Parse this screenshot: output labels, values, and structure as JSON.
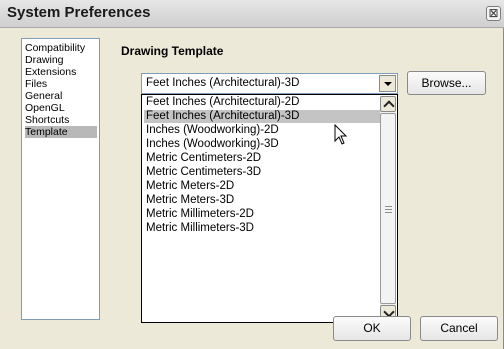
{
  "window": {
    "title": "System Preferences",
    "close_symbol": "⊠"
  },
  "sidebar": {
    "items": [
      {
        "label": "Compatibility"
      },
      {
        "label": "Drawing"
      },
      {
        "label": "Extensions"
      },
      {
        "label": "Files"
      },
      {
        "label": "General"
      },
      {
        "label": "OpenGL"
      },
      {
        "label": "Shortcuts"
      },
      {
        "label": "Template"
      }
    ],
    "selected_index": 7
  },
  "main": {
    "heading": "Drawing Template",
    "template_select": {
      "value": "Feet Inches (Architectural)-3D",
      "options": [
        "Feet Inches (Architectural)-2D",
        "Feet Inches (Architectural)-3D",
        "Inches (Woodworking)-2D",
        "Inches (Woodworking)-3D",
        "Metric Centimeters-2D",
        "Metric Centimeters-3D",
        "Metric Meters-2D",
        "Metric Meters-3D",
        "Metric Millimeters-2D",
        "Metric Millimeters-3D"
      ],
      "highlighted_index": 1
    },
    "browse_label": "Browse..."
  },
  "footer": {
    "ok_label": "OK",
    "cancel_label": "Cancel"
  },
  "icons": {
    "close": "close-icon",
    "dropdown": "chevron-down-icon",
    "scroll_up": "chevron-up-icon",
    "scroll_down": "chevron-down-icon",
    "cursor": "mouse-pointer-icon"
  }
}
